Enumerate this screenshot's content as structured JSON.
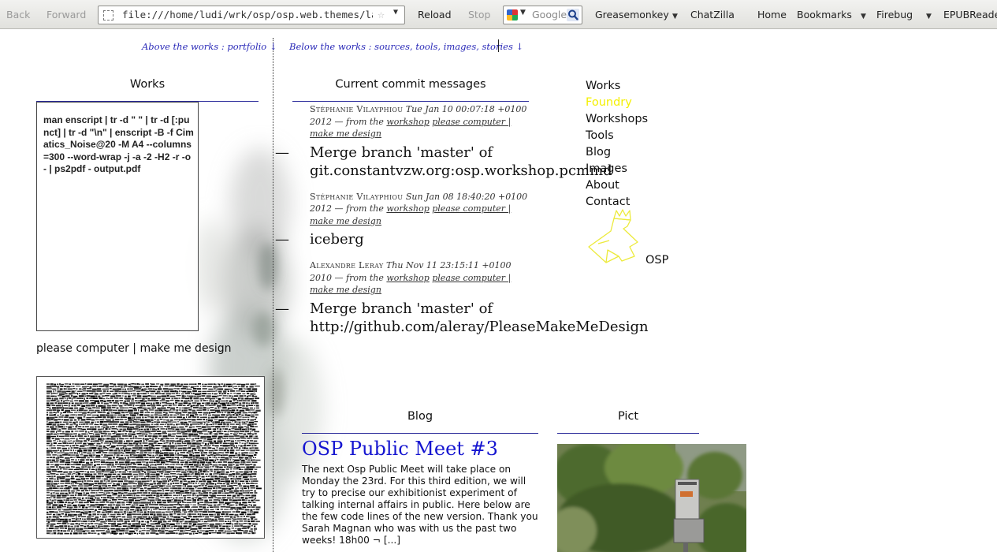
{
  "browser": {
    "back_label": "Back",
    "forward_label": "Forward",
    "url": "file:///home/ludi/wrk/osp/osp.web.themes/layou",
    "reload_label": "Reload",
    "stop_label": "Stop",
    "search_placeholder": "Google",
    "toolbar_items": {
      "greasemonkey": "Greasemonkey",
      "chatzilla": "ChatZilla",
      "home": "Home",
      "bookmarks": "Bookmarks",
      "firebug": "Firebug",
      "epubreader": "EPUBReader"
    }
  },
  "page": {
    "above_link": "Above the works : portfolio ↓",
    "below_link": "Below the works : sources, tools, images, stories ↓",
    "works": {
      "heading": "Works",
      "code": "man enscript | tr -d \" \" | tr -d [:punct] | tr -d \"\\n\" | enscript -B -f Cimatics_Noise@20 -M A4 --columns=300 --word-wrap -j -a -2 -H2 -r -o - | ps2pdf - output.pdf",
      "caption": "please computer | make me design"
    },
    "commits": {
      "heading": "Current commit messages",
      "items": [
        {
          "author": "Stéphanie Vilayphiou",
          "date": "Tue Jan 10 00:07:18 +0100 2012",
          "from": "— from the",
          "link_workshop": "workshop",
          "link_project": "please computer | make me design",
          "message": "Merge branch 'master' of git.constantvzw.org:osp.workshop.pcmmd"
        },
        {
          "author": "Stéphanie Vilayphiou",
          "date": "Sun Jan 08 18:40:20 +0100 2012",
          "from": "— from the",
          "link_workshop": "workshop",
          "link_project": "please computer | make me design",
          "message": "iceberg"
        },
        {
          "author": "Alexandre Leray",
          "date": "Thu Nov 11 23:15:11 +0100 2010",
          "from": "— from the",
          "link_workshop": "workshop",
          "link_project": "please computer | make me design",
          "message": "Merge branch 'master' of http://github.com/aleray/PleaseMakeMeDesign"
        }
      ],
      "dash": "—"
    },
    "nav": {
      "items": [
        "Works",
        "Foundry",
        "Workshops",
        "Tools",
        "Blog",
        "Images",
        "About",
        "Contact"
      ],
      "active": "Foundry",
      "logo_label": "OSP"
    },
    "blog": {
      "heading": "Blog",
      "title": "OSP Public Meet #3",
      "text": "The next Osp Public Meet will take place on Monday the 23rd. For this third edition, we will try to precise our exhibitionist experiment of talking internal affairs in public. Here below are the few code lines of the new version. Thank you Sarah Magnan who was with us the past two weeks! 18h00 ¬ [...]"
    },
    "pict": {
      "heading": "Pict"
    }
  },
  "colors": {
    "link_blue": "#2a2ab8",
    "title_blue": "#1515d0",
    "nav_active": "#f4f000",
    "rule": "#2a2a9a"
  }
}
